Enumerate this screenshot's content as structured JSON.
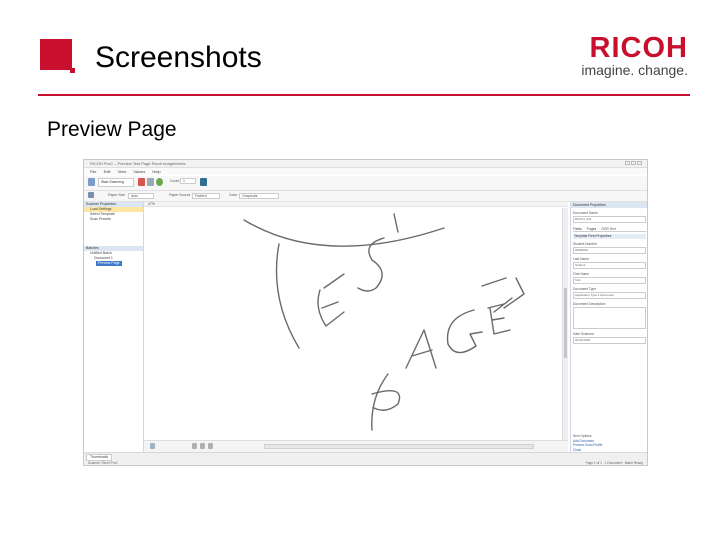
{
  "slide": {
    "title": "Screenshots",
    "subtitle": "Preview Page",
    "brand_name": "RICOH",
    "brand_tagline": "imagine. change.",
    "accent_color": "#c8102e"
  },
  "app": {
    "window_title": "RICOH ProC – Preview Test Page Ricoh ImageWorks",
    "menu": [
      "File",
      "Edit",
      "View",
      "Values",
      "Help"
    ],
    "toolbar": {
      "start_scanning_label": "Start Scanning",
      "count_label": "Count",
      "count_value": "1"
    },
    "toolbar2": {
      "paper_size_label": "Paper Size",
      "paper_size_value": "Auto",
      "paper_source_label": "Paper Source",
      "paper_source_value": "Flatbed",
      "color_label": "Color",
      "color_value": "Grayscale"
    },
    "left_pane": {
      "header": "Scanner Properties",
      "items": [
        "Load Settings",
        "Select Template",
        "Scan Presets"
      ],
      "tree_header": "Batches",
      "tree_items": [
        "Untitled Batch",
        "Document 1"
      ],
      "tree_selected": "Preview Page"
    },
    "canvas": {
      "zoom": "47%"
    },
    "right_pane": {
      "header": "Document Properties",
      "doc_name_label": "Document Name",
      "doc_name_value": "RICOH_001",
      "tabs": [
        "Fields",
        "Pages",
        "OCR Text"
      ],
      "section": "Template Field Properties",
      "fields": [
        {
          "label": "Student Number",
          "value": "00000001"
        },
        {
          "label": "Last Name",
          "value": "Student"
        },
        {
          "label": "First Name",
          "value": "Test"
        },
        {
          "label": "Document Type",
          "value": "Application Type 1 Document"
        }
      ],
      "description_label": "Document Description",
      "date_label": "Date Scanned",
      "date_value": "00-00-0000",
      "links_header": "Next Options",
      "links": [
        "Add Document",
        "Preview Scan Profile",
        "Close"
      ]
    },
    "status": {
      "thumbnails_tab": "Thumbnails",
      "left": "Scanner: Ricoh ProC",
      "right": "Page 1 of 1 · 1 Document · Batch Ready"
    }
  }
}
